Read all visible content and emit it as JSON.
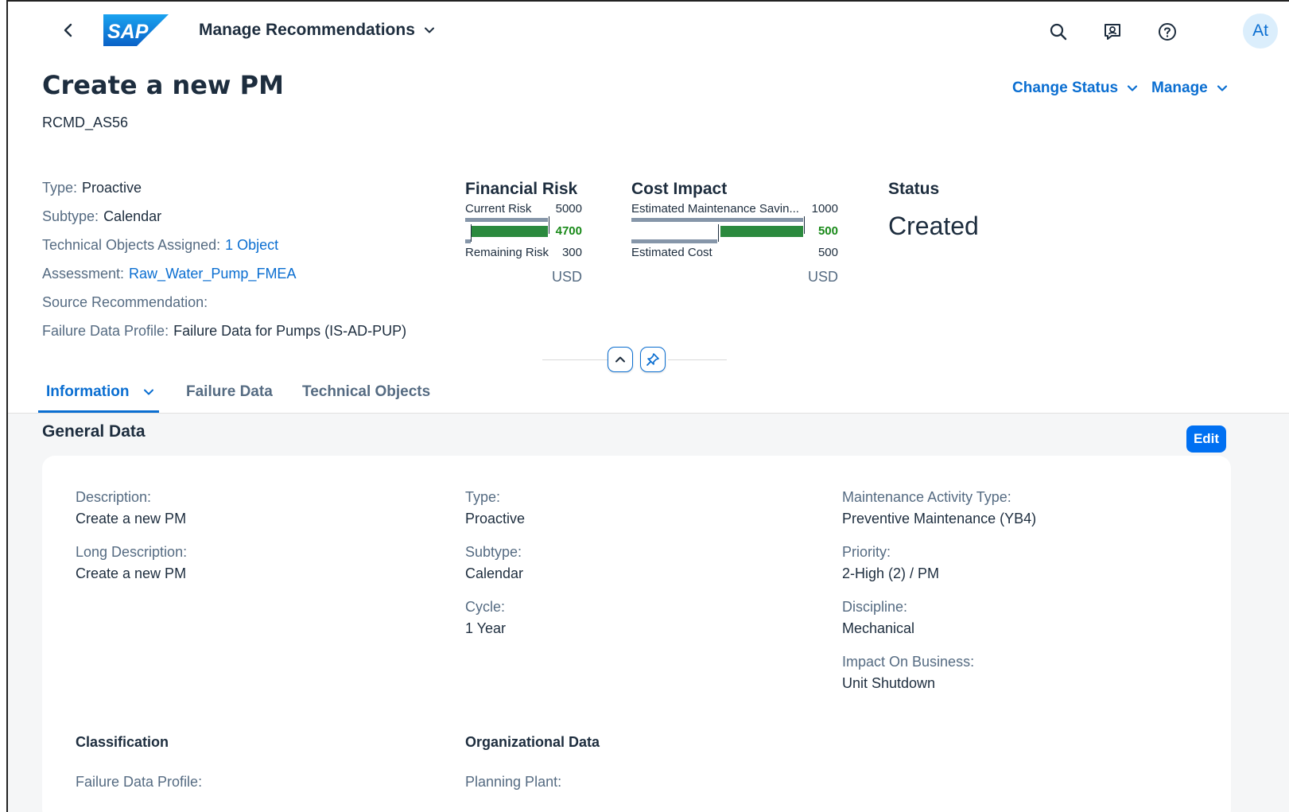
{
  "shell": {
    "app_title": "Manage Recommendations",
    "logo_text": "SAP",
    "avatar_initials": "At",
    "brand_color": "#0a6ed1"
  },
  "header": {
    "title": "Create a new PM",
    "subtitle": "RCMD_AS56",
    "actions": {
      "change_status": "Change Status",
      "manage": "Manage"
    },
    "attributes": {
      "type_label": "Type:",
      "type_value": "Proactive",
      "subtype_label": "Subtype:",
      "subtype_value": "Calendar",
      "tech_objects_label": "Technical Objects Assigned:",
      "tech_objects_value": "1 Object",
      "assessment_label": "Assessment:",
      "assessment_value": "Raw_Water_Pump_FMEA",
      "source_label": "Source Recommendation:",
      "fdp_label": "Failure Data Profile:",
      "fdp_value": "Failure Data for Pumps (IS-AD-PUP)"
    }
  },
  "kpis": {
    "financial_risk": {
      "title": "Financial Risk",
      "row1_label": "Current Risk",
      "row1_value": "5000",
      "delta_value": "4700",
      "row2_label": "Remaining Risk",
      "row2_value": "300",
      "unit": "USD",
      "current": 5000,
      "remaining": 300
    },
    "cost_impact": {
      "title": "Cost Impact",
      "row1_label": "Estimated Maintenance Savin...",
      "row1_value": "1000",
      "delta_value": "500",
      "row2_label": "Estimated Cost",
      "row2_value": "500",
      "unit": "USD",
      "savings": 1000,
      "cost": 500
    },
    "status": {
      "title": "Status",
      "value": "Created"
    }
  },
  "tabs": [
    {
      "label": "Information"
    },
    {
      "label": "Failure Data"
    },
    {
      "label": "Technical Objects"
    }
  ],
  "general_data": {
    "title": "General Data",
    "edit_label": "Edit",
    "col1": {
      "description_label": "Description:",
      "description_value": "Create a new PM",
      "long_description_label": "Long Description:",
      "long_description_value": "Create a new PM"
    },
    "col2": {
      "type_label": "Type:",
      "type_value": "Proactive",
      "subtype_label": "Subtype:",
      "subtype_value": "Calendar",
      "cycle_label": "Cycle:",
      "cycle_value": "1 Year"
    },
    "col3": {
      "mat_label": "Maintenance Activity Type:",
      "mat_value": "Preventive Maintenance (YB4)",
      "priority_label": "Priority:",
      "priority_value": "2-High (2) / PM",
      "discipline_label": "Discipline:",
      "discipline_value": "Mechanical",
      "impact_label": "Impact On Business:",
      "impact_value": "Unit Shutdown"
    },
    "classification": {
      "title": "Classification",
      "fdp_label": "Failure Data Profile:"
    },
    "organizational": {
      "title": "Organizational Data",
      "plant_label": "Planning Plant:"
    }
  }
}
